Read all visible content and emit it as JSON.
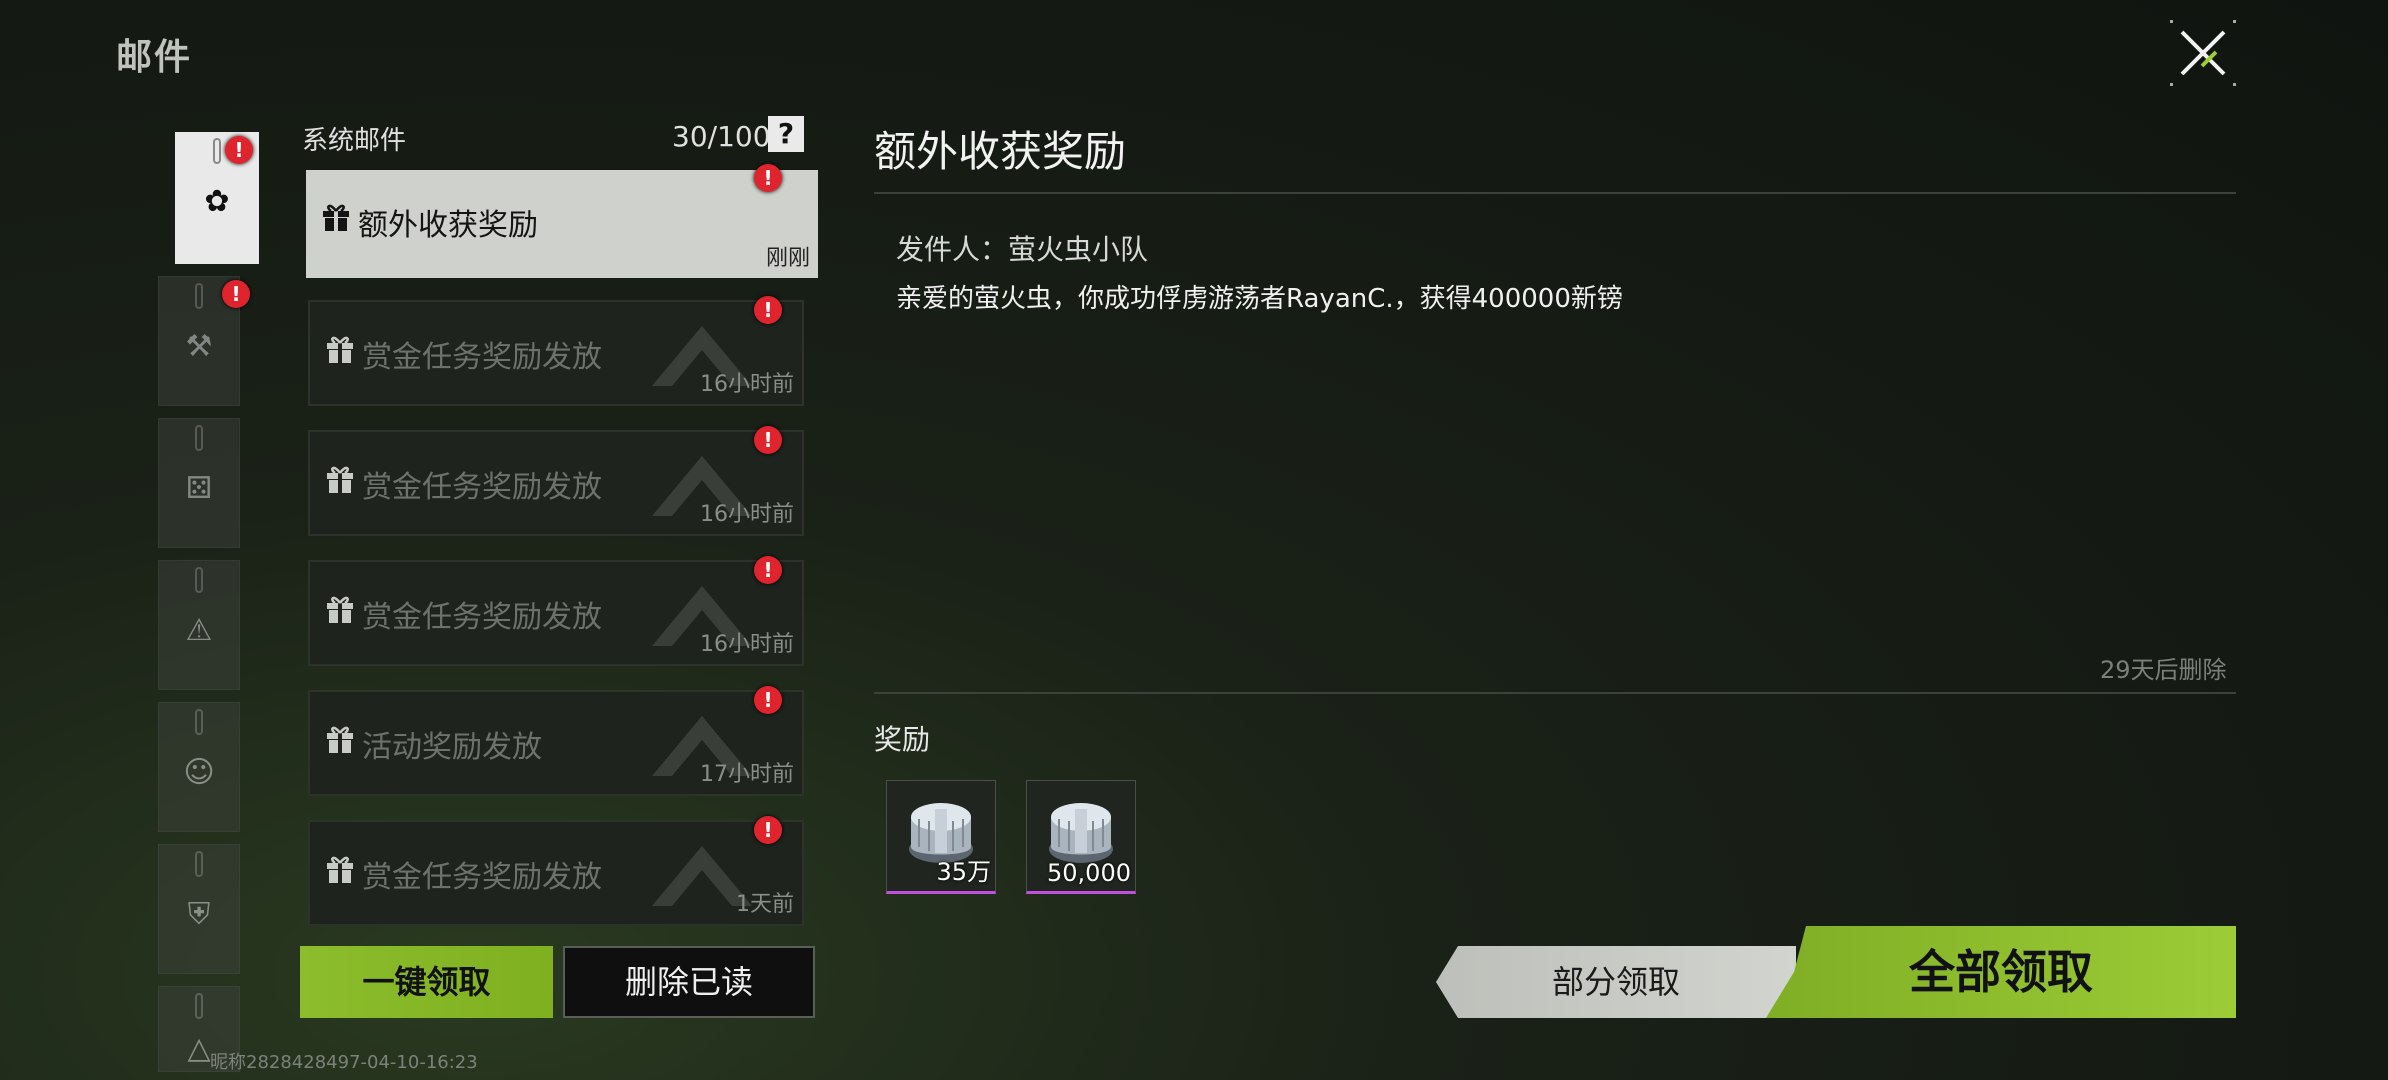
{
  "header": {
    "title": "邮件"
  },
  "categories": [
    {
      "icon": "gear-icon",
      "active": true,
      "badge": "!"
    },
    {
      "icon": "hammer-icon",
      "active": false,
      "badge": "!"
    },
    {
      "icon": "dice-icon",
      "active": false,
      "badge": ""
    },
    {
      "icon": "warning-icon",
      "active": false,
      "badge": ""
    },
    {
      "icon": "face-icon",
      "active": false,
      "badge": ""
    },
    {
      "icon": "vest-icon",
      "active": false,
      "badge": ""
    },
    {
      "icon": "triangle-logo-icon",
      "active": false,
      "badge": ""
    }
  ],
  "mail_list": {
    "section_title": "系统邮件",
    "count": "30/100",
    "help": "?",
    "items": [
      {
        "title": "额外收获奖励",
        "time": "刚刚",
        "badge": "!"
      },
      {
        "title": "赏金任务奖励发放",
        "time": "16小时前",
        "badge": "!"
      },
      {
        "title": "赏金任务奖励发放",
        "time": "16小时前",
        "badge": "!"
      },
      {
        "title": "赏金任务奖励发放",
        "time": "16小时前",
        "badge": "!"
      },
      {
        "title": "活动奖励发放",
        "time": "17小时前",
        "badge": "!"
      },
      {
        "title": "赏金任务奖励发放",
        "time": "1天前",
        "badge": "!"
      }
    ],
    "claim_all_label": "一键领取",
    "delete_read_label": "删除已读"
  },
  "footer": {
    "info": "昵称2828428497-04-10-16:23"
  },
  "detail": {
    "title": "额外收获奖励",
    "sender": "发件人：萤火虫小队",
    "body": "亲爱的萤火虫，你成功俘虏游荡者RayanC.，获得400000新镑",
    "expire": "29天后删除",
    "reward_label": "奖励",
    "rewards": [
      {
        "icon": "cash-roll-icon",
        "amount": "35万"
      },
      {
        "icon": "cash-roll-icon",
        "amount": "50,000"
      }
    ],
    "partial_claim_label": "部分领取",
    "claim_all_label": "全部领取"
  },
  "colors": {
    "accent_green": "#8cbd2c",
    "badge_red": "#e0242e",
    "rarity_purple": "#c24fe0"
  }
}
